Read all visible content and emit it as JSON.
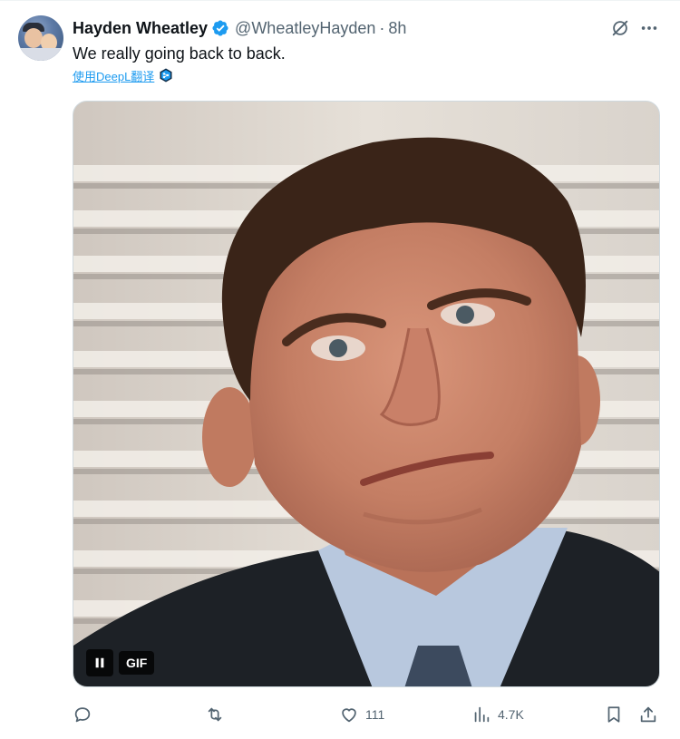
{
  "tweet": {
    "author": {
      "display_name": "Hayden Wheatley",
      "handle": "@WheatleyHayden",
      "verified": true,
      "avatar_icon": "user-avatar"
    },
    "separator": "·",
    "time": "8h",
    "text": "We really going back to back.",
    "translate_label": "使用DeepL翻译",
    "media": {
      "badge": "GIF",
      "pause_icon": "pause-icon"
    },
    "actions": {
      "reply_count": "",
      "repost_count": "",
      "like_count": "111",
      "views_count": "4.7K"
    }
  },
  "colors": {
    "accent": "#1d9bf0",
    "secondary_text": "#536471",
    "primary_text": "#0f1419"
  }
}
